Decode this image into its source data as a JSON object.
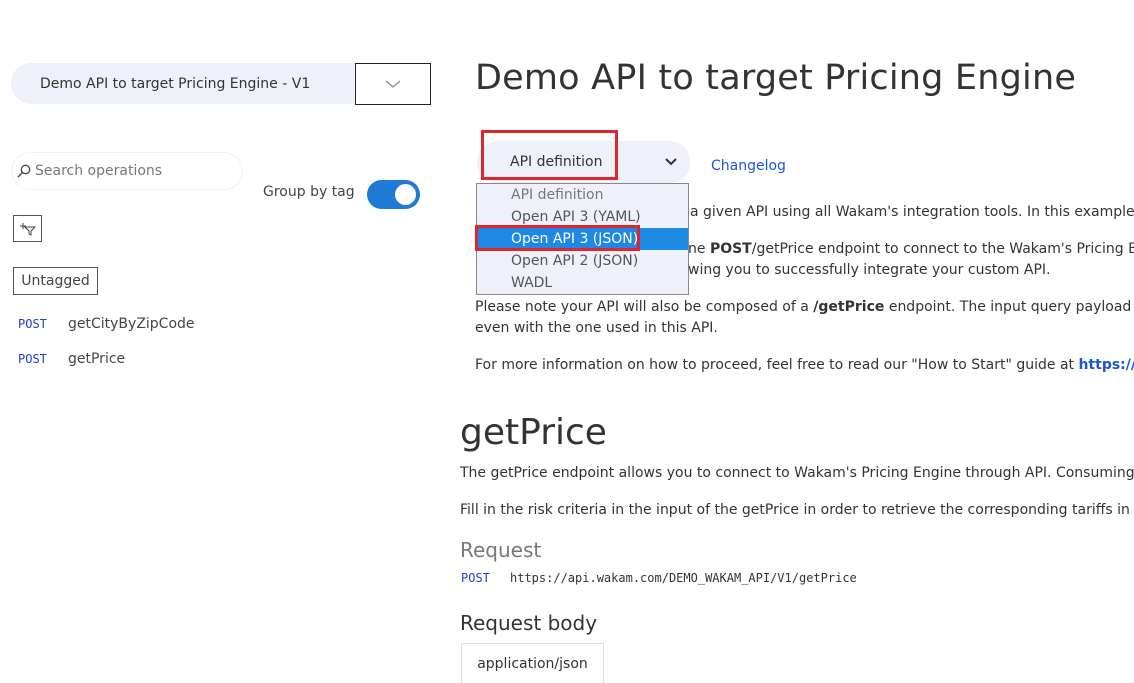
{
  "sidebar": {
    "api_selector_label": "Demo API to target Pricing Engine - V1",
    "search_placeholder": "Search operations",
    "group_by_tag_label": "Group by tag",
    "group_by_tag_on": true,
    "tag_label": "Untagged",
    "operations": [
      {
        "method": "POST",
        "name": "getCityByZipCode"
      },
      {
        "method": "POST",
        "name": "getPrice"
      }
    ]
  },
  "main": {
    "title": "Demo API to target Pricing Engine",
    "definition_select_value": "API definition",
    "changelog_label": "Changelog",
    "dropdown_options": [
      "API definition",
      "Open API 3 (YAML)",
      "Open API 3 (JSON)",
      "Open API 2 (JSON)",
      "WADL"
    ],
    "dropdown_selected": "Open API 3 (JSON)",
    "intro": {
      "line1_tail": "a given API using all Wakam's integration tools. In this example, t",
      "line2_pre": "ne ",
      "line2_bold": "POST",
      "line2_tail": "/getPrice endpoint to connect to the Wakam's Pricing Eng",
      "line3_tail": "wing you to successfully integrate your custom API.",
      "line4_pre": "Please note your API will also be composed of a ",
      "line4_bold": "/getPrice",
      "line4_tail": " endpoint. The input query payload wi",
      "line5": "even with the one used in this API.",
      "line6_pre": "For more information on how to proceed, feel free to read our \"How to Start\" guide at ",
      "line6_link": "https://de"
    },
    "section_title": "getPrice",
    "section_p1": "The getPrice endpoint allows you to connect to Wakam's Pricing Engine through API. Consuming t",
    "section_p2": "Fill in the risk criteria in the input of the getPrice in order to retrieve the corresponding tariffs in the",
    "request_heading": "Request",
    "request_method": "POST",
    "request_url": "https://api.wakam.com/DEMO_WAKAM_API/V1/getPrice",
    "request_body_heading": "Request body",
    "content_type_tab": "application/json"
  },
  "colors": {
    "accent": "#1f7ad6",
    "highlight_box": "#e0262a",
    "method_blue": "#1a3fcf",
    "selected_option": "#1e88e5"
  }
}
